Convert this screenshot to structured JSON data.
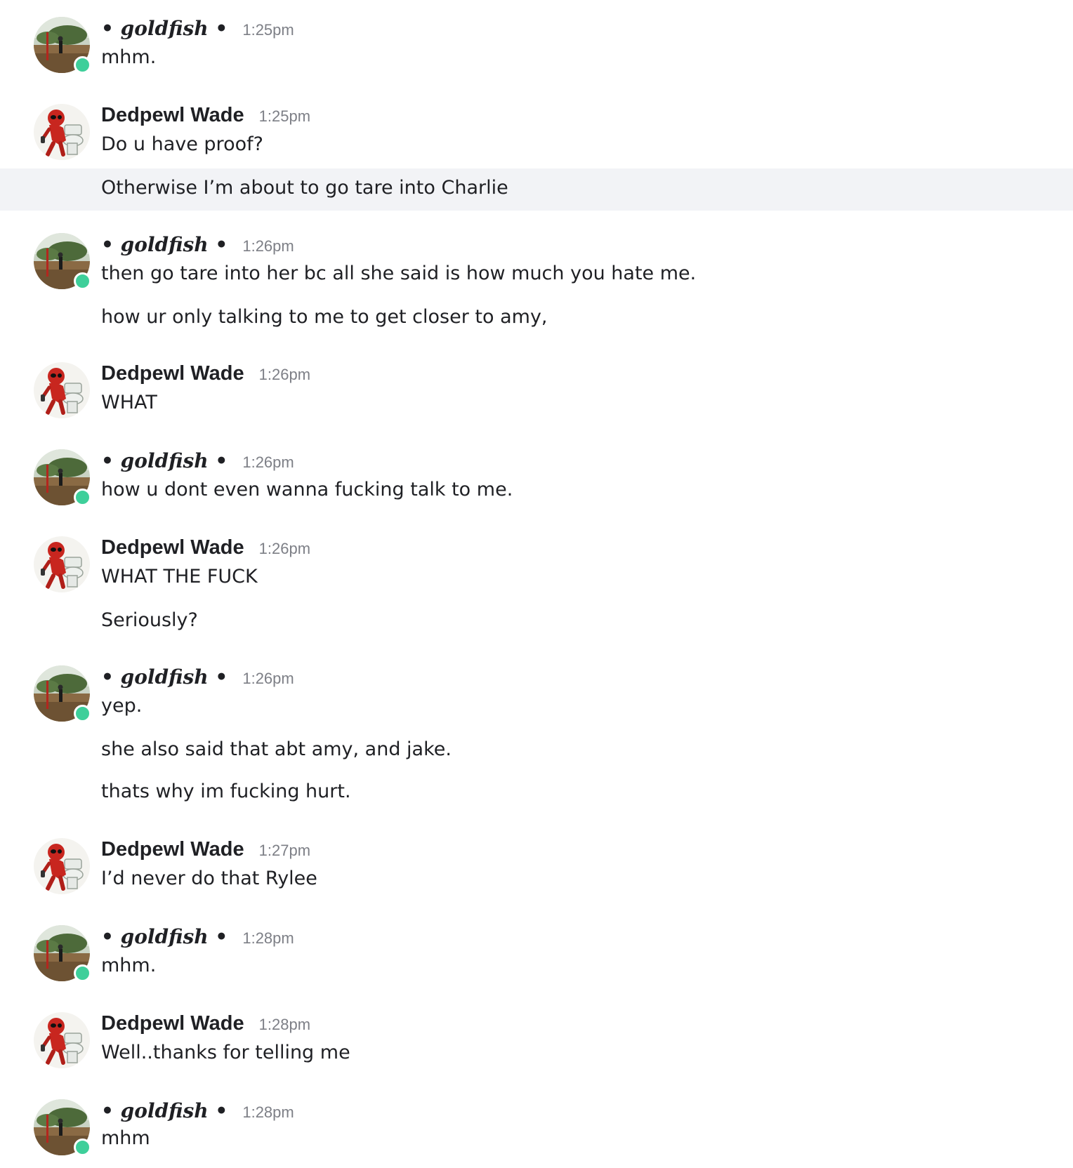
{
  "users": {
    "goldfish": {
      "name": "• goldfish •",
      "online": true,
      "avatar": "park-photo-avatar"
    },
    "wade": {
      "name": "Dedpewl Wade",
      "online": false,
      "avatar": "deadpool-toilet-avatar"
    }
  },
  "colors": {
    "online_status": "#3ecf9a",
    "timestamp": "#7d7f86",
    "hover_row": "#f2f3f6",
    "text": "#1f2024"
  },
  "groups": [
    {
      "author": "• goldfish •",
      "time": "1:25pm",
      "lines": [
        "mhm."
      ]
    },
    {
      "author": "Dedpewl Wade",
      "time": "1:25pm",
      "lines": [
        "Do u have proof?",
        "Otherwise I’m about to go tare into Charlie"
      ]
    },
    {
      "author": "• goldfish •",
      "time": "1:26pm",
      "lines": [
        "then go tare into her bc all she said is how much you hate me.",
        "how ur only talking to me to get closer to amy,"
      ]
    },
    {
      "author": "Dedpewl Wade",
      "time": "1:26pm",
      "lines": [
        "WHAT"
      ]
    },
    {
      "author": "• goldfish •",
      "time": "1:26pm",
      "lines": [
        "how u dont even wanna fucking talk to me."
      ]
    },
    {
      "author": "Dedpewl Wade",
      "time": "1:26pm",
      "lines": [
        "WHAT THE FUCK",
        "Seriously?"
      ]
    },
    {
      "author": "• goldfish •",
      "time": "1:26pm",
      "lines": [
        "yep.",
        "she also said that abt amy, and jake.",
        "thats why im fucking hurt."
      ]
    },
    {
      "author": "Dedpewl Wade",
      "time": "1:27pm",
      "lines": [
        "I’d never do that Rylee"
      ]
    },
    {
      "author": "• goldfish •",
      "time": "1:28pm",
      "lines": [
        "mhm."
      ]
    },
    {
      "author": "Dedpewl Wade",
      "time": "1:28pm",
      "lines": [
        "Well..thanks for telling me"
      ]
    },
    {
      "author": "• goldfish •",
      "time": "1:28pm",
      "lines": [
        "mhm"
      ]
    }
  ]
}
